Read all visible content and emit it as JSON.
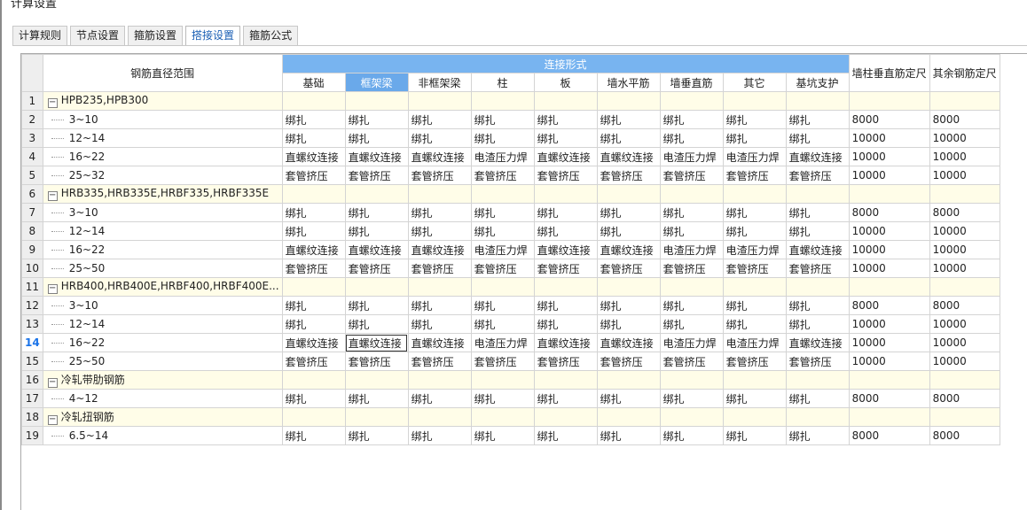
{
  "window": {
    "title": "计算设置"
  },
  "tabs": [
    {
      "label": "计算规则",
      "active": false
    },
    {
      "label": "节点设置",
      "active": false
    },
    {
      "label": "箍筋设置",
      "active": false
    },
    {
      "label": "搭接设置",
      "active": true
    },
    {
      "label": "箍筋公式",
      "active": false
    }
  ],
  "grid": {
    "range_header": "钢筋直径范围",
    "group_header": "连接形式",
    "columns": [
      "基础",
      "框架梁",
      "非框架梁",
      "柱",
      "板",
      "墙水平筋",
      "墙垂直筋",
      "其它",
      "基坑支护"
    ],
    "extra_columns": [
      "墙柱垂直筋定尺",
      "其余钢筋定尺"
    ],
    "selected_column_index": 1,
    "current_row": 14,
    "rows": [
      {
        "num": "1",
        "type": "group",
        "label": "HPB235,HPB300"
      },
      {
        "num": "2",
        "type": "item",
        "label": "3~10",
        "cells": [
          "绑扎",
          "绑扎",
          "绑扎",
          "绑扎",
          "绑扎",
          "绑扎",
          "绑扎",
          "绑扎",
          "绑扎",
          "8000",
          "8000"
        ]
      },
      {
        "num": "3",
        "type": "item",
        "label": "12~14",
        "cells": [
          "绑扎",
          "绑扎",
          "绑扎",
          "绑扎",
          "绑扎",
          "绑扎",
          "绑扎",
          "绑扎",
          "绑扎",
          "10000",
          "10000"
        ]
      },
      {
        "num": "4",
        "type": "item",
        "label": "16~22",
        "cells": [
          "直螺纹连接",
          "直螺纹连接",
          "直螺纹连接",
          "电渣压力焊",
          "直螺纹连接",
          "直螺纹连接",
          "电渣压力焊",
          "电渣压力焊",
          "直螺纹连接",
          "10000",
          "10000"
        ]
      },
      {
        "num": "5",
        "type": "item",
        "label": "25~32",
        "cells": [
          "套管挤压",
          "套管挤压",
          "套管挤压",
          "套管挤压",
          "套管挤压",
          "套管挤压",
          "套管挤压",
          "套管挤压",
          "套管挤压",
          "10000",
          "10000"
        ]
      },
      {
        "num": "6",
        "type": "group",
        "label": "HRB335,HRB335E,HRBF335,HRBF335E"
      },
      {
        "num": "7",
        "type": "item",
        "label": "3~10",
        "cells": [
          "绑扎",
          "绑扎",
          "绑扎",
          "绑扎",
          "绑扎",
          "绑扎",
          "绑扎",
          "绑扎",
          "绑扎",
          "8000",
          "8000"
        ]
      },
      {
        "num": "8",
        "type": "item",
        "label": "12~14",
        "cells": [
          "绑扎",
          "绑扎",
          "绑扎",
          "绑扎",
          "绑扎",
          "绑扎",
          "绑扎",
          "绑扎",
          "绑扎",
          "10000",
          "10000"
        ]
      },
      {
        "num": "9",
        "type": "item",
        "label": "16~22",
        "cells": [
          "直螺纹连接",
          "直螺纹连接",
          "直螺纹连接",
          "电渣压力焊",
          "直螺纹连接",
          "直螺纹连接",
          "电渣压力焊",
          "电渣压力焊",
          "直螺纹连接",
          "10000",
          "10000"
        ]
      },
      {
        "num": "10",
        "type": "item",
        "label": "25~50",
        "cells": [
          "套管挤压",
          "套管挤压",
          "套管挤压",
          "套管挤压",
          "套管挤压",
          "套管挤压",
          "套管挤压",
          "套管挤压",
          "套管挤压",
          "10000",
          "10000"
        ]
      },
      {
        "num": "11",
        "type": "group",
        "label": "HRB400,HRB400E,HRBF400,HRBF400E..."
      },
      {
        "num": "12",
        "type": "item",
        "label": "3~10",
        "cells": [
          "绑扎",
          "绑扎",
          "绑扎",
          "绑扎",
          "绑扎",
          "绑扎",
          "绑扎",
          "绑扎",
          "绑扎",
          "8000",
          "8000"
        ]
      },
      {
        "num": "13",
        "type": "item",
        "label": "12~14",
        "cells": [
          "绑扎",
          "绑扎",
          "绑扎",
          "绑扎",
          "绑扎",
          "绑扎",
          "绑扎",
          "绑扎",
          "绑扎",
          "10000",
          "10000"
        ]
      },
      {
        "num": "14",
        "type": "item",
        "label": "16~22",
        "cells": [
          "直螺纹连接",
          "直螺纹连接",
          "直螺纹连接",
          "电渣压力焊",
          "直螺纹连接",
          "直螺纹连接",
          "电渣压力焊",
          "电渣压力焊",
          "直螺纹连接",
          "10000",
          "10000"
        ]
      },
      {
        "num": "15",
        "type": "item",
        "label": "25~50",
        "cells": [
          "套管挤压",
          "套管挤压",
          "套管挤压",
          "套管挤压",
          "套管挤压",
          "套管挤压",
          "套管挤压",
          "套管挤压",
          "套管挤压",
          "10000",
          "10000"
        ]
      },
      {
        "num": "16",
        "type": "group",
        "label": "冷轧带肋钢筋"
      },
      {
        "num": "17",
        "type": "item",
        "label": "4~12",
        "cells": [
          "绑扎",
          "绑扎",
          "绑扎",
          "绑扎",
          "绑扎",
          "绑扎",
          "绑扎",
          "绑扎",
          "绑扎",
          "8000",
          "8000"
        ]
      },
      {
        "num": "18",
        "type": "group",
        "label": "冷轧扭钢筋"
      },
      {
        "num": "19",
        "type": "item",
        "label": "6.5~14",
        "cells": [
          "绑扎",
          "绑扎",
          "绑扎",
          "绑扎",
          "绑扎",
          "绑扎",
          "绑扎",
          "绑扎",
          "绑扎",
          "8000",
          "8000"
        ]
      }
    ]
  },
  "icons": {
    "collapse": "collapse-minus-icon",
    "tree_connector": "tree-line-icon"
  },
  "colors": {
    "group_header_bg": "#78b4f0",
    "selected_column_bg": "#6aa9ea",
    "group_row_bg": "#fffde8",
    "current_row_text": "#1a73e8"
  }
}
